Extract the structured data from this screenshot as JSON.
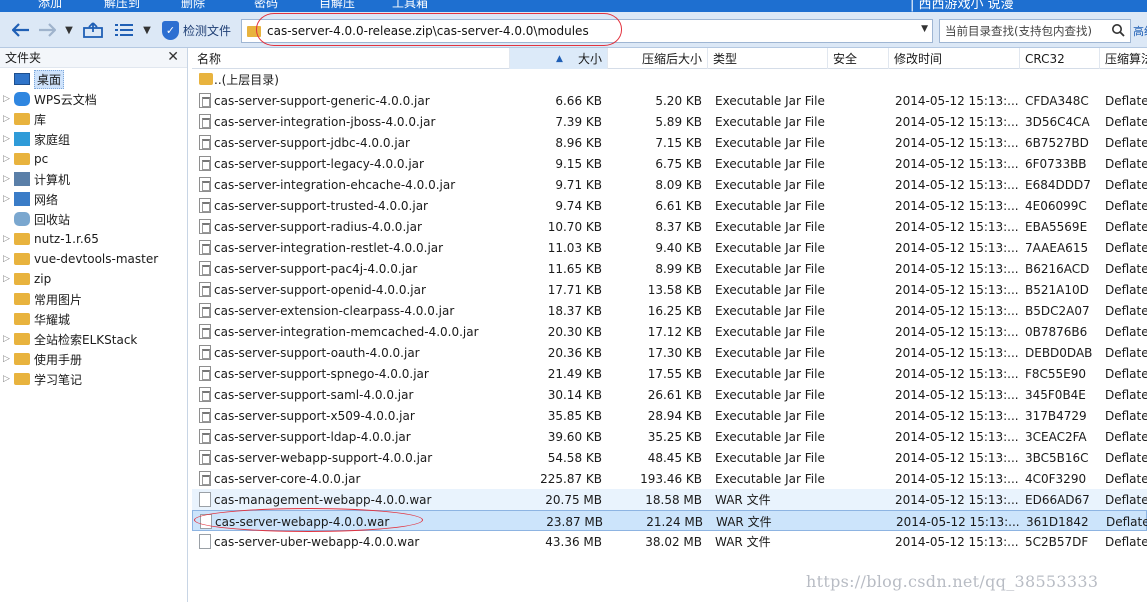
{
  "ribbon": {
    "items": [
      "添加",
      "解压到",
      "删除",
      "密码",
      "自解压",
      "工具箱"
    ],
    "right_text": "| 西西游戏小 说漫"
  },
  "nav": {
    "back_icon": "back-arrow-icon",
    "forward_icon": "forward-arrow-icon",
    "detect_label": "检测文件",
    "path": "cas-server-4.0.0-release.zip\\cas-server-4.0.0\\modules",
    "search_placeholder": "当前目录查找(支持包内查找)",
    "advanced": "高级"
  },
  "tree": {
    "title": "文件夹",
    "items": [
      {
        "label": "桌面",
        "icon": "desktop-icon",
        "selected": true
      },
      {
        "label": "WPS云文档",
        "icon": "cloud-icon"
      },
      {
        "label": "库",
        "icon": "library-icon"
      },
      {
        "label": "家庭组",
        "icon": "homegroup-icon"
      },
      {
        "label": "pc",
        "icon": "user-folder-icon"
      },
      {
        "label": "计算机",
        "icon": "computer-icon"
      },
      {
        "label": "网络",
        "icon": "network-icon"
      },
      {
        "label": "回收站",
        "icon": "recycle-bin-icon"
      },
      {
        "label": "nutz-1.r.65",
        "icon": "folder-icon"
      },
      {
        "label": "vue-devtools-master",
        "icon": "folder-icon"
      },
      {
        "label": "zip",
        "icon": "folder-icon"
      },
      {
        "label": "常用图片",
        "icon": "folder-icon"
      },
      {
        "label": "华耀城",
        "icon": "folder-icon"
      },
      {
        "label": "全站检索ELKStack",
        "icon": "folder-icon"
      },
      {
        "label": "使用手册",
        "icon": "folder-icon"
      },
      {
        "label": "学习笔记",
        "icon": "folder-icon"
      }
    ]
  },
  "columns": {
    "name": "名称",
    "size": "大小",
    "packed": "压缩后大小",
    "type": "类型",
    "security": "安全",
    "modified": "修改时间",
    "crc": "CRC32",
    "method": "压缩算法"
  },
  "up_row": "..(上层目录)",
  "files": [
    {
      "name": "cas-server-support-generic-4.0.0.jar",
      "size": "6.66 KB",
      "packed": "5.20 KB",
      "type": "Executable Jar File",
      "modified": "2014-05-12 15:13:...",
      "crc": "CFDA348C",
      "method": "Deflate"
    },
    {
      "name": "cas-server-integration-jboss-4.0.0.jar",
      "size": "7.39 KB",
      "packed": "5.89 KB",
      "type": "Executable Jar File",
      "modified": "2014-05-12 15:13:...",
      "crc": "3D56C4CA",
      "method": "Deflate"
    },
    {
      "name": "cas-server-support-jdbc-4.0.0.jar",
      "size": "8.96 KB",
      "packed": "7.15 KB",
      "type": "Executable Jar File",
      "modified": "2014-05-12 15:13:...",
      "crc": "6B7527BD",
      "method": "Deflate"
    },
    {
      "name": "cas-server-support-legacy-4.0.0.jar",
      "size": "9.15 KB",
      "packed": "6.75 KB",
      "type": "Executable Jar File",
      "modified": "2014-05-12 15:13:...",
      "crc": "6F0733BB",
      "method": "Deflate"
    },
    {
      "name": "cas-server-integration-ehcache-4.0.0.jar",
      "size": "9.71 KB",
      "packed": "8.09 KB",
      "type": "Executable Jar File",
      "modified": "2014-05-12 15:13:...",
      "crc": "E684DDD7",
      "method": "Deflate"
    },
    {
      "name": "cas-server-support-trusted-4.0.0.jar",
      "size": "9.74 KB",
      "packed": "6.61 KB",
      "type": "Executable Jar File",
      "modified": "2014-05-12 15:13:...",
      "crc": "4E06099C",
      "method": "Deflate"
    },
    {
      "name": "cas-server-support-radius-4.0.0.jar",
      "size": "10.70 KB",
      "packed": "8.37 KB",
      "type": "Executable Jar File",
      "modified": "2014-05-12 15:13:...",
      "crc": "EBA5569E",
      "method": "Deflate"
    },
    {
      "name": "cas-server-integration-restlet-4.0.0.jar",
      "size": "11.03 KB",
      "packed": "9.40 KB",
      "type": "Executable Jar File",
      "modified": "2014-05-12 15:13:...",
      "crc": "7AAEA615",
      "method": "Deflate"
    },
    {
      "name": "cas-server-support-pac4j-4.0.0.jar",
      "size": "11.65 KB",
      "packed": "8.99 KB",
      "type": "Executable Jar File",
      "modified": "2014-05-12 15:13:...",
      "crc": "B6216ACD",
      "method": "Deflate"
    },
    {
      "name": "cas-server-support-openid-4.0.0.jar",
      "size": "17.71 KB",
      "packed": "13.58 KB",
      "type": "Executable Jar File",
      "modified": "2014-05-12 15:13:...",
      "crc": "B521A10D",
      "method": "Deflate"
    },
    {
      "name": "cas-server-extension-clearpass-4.0.0.jar",
      "size": "18.37 KB",
      "packed": "16.25 KB",
      "type": "Executable Jar File",
      "modified": "2014-05-12 15:13:...",
      "crc": "B5DC2A07",
      "method": "Deflate"
    },
    {
      "name": "cas-server-integration-memcached-4.0.0.jar",
      "size": "20.30 KB",
      "packed": "17.12 KB",
      "type": "Executable Jar File",
      "modified": "2014-05-12 15:13:...",
      "crc": "0B7876B6",
      "method": "Deflate"
    },
    {
      "name": "cas-server-support-oauth-4.0.0.jar",
      "size": "20.36 KB",
      "packed": "17.30 KB",
      "type": "Executable Jar File",
      "modified": "2014-05-12 15:13:...",
      "crc": "DEBD0DAB",
      "method": "Deflate"
    },
    {
      "name": "cas-server-support-spnego-4.0.0.jar",
      "size": "21.49 KB",
      "packed": "17.55 KB",
      "type": "Executable Jar File",
      "modified": "2014-05-12 15:13:...",
      "crc": "F8C55E90",
      "method": "Deflate"
    },
    {
      "name": "cas-server-support-saml-4.0.0.jar",
      "size": "30.14 KB",
      "packed": "26.61 KB",
      "type": "Executable Jar File",
      "modified": "2014-05-12 15:13:...",
      "crc": "345F0B4E",
      "method": "Deflate"
    },
    {
      "name": "cas-server-support-x509-4.0.0.jar",
      "size": "35.85 KB",
      "packed": "28.94 KB",
      "type": "Executable Jar File",
      "modified": "2014-05-12 15:13:...",
      "crc": "317B4729",
      "method": "Deflate"
    },
    {
      "name": "cas-server-support-ldap-4.0.0.jar",
      "size": "39.60 KB",
      "packed": "35.25 KB",
      "type": "Executable Jar File",
      "modified": "2014-05-12 15:13:...",
      "crc": "3CEAC2FA",
      "method": "Deflate"
    },
    {
      "name": "cas-server-webapp-support-4.0.0.jar",
      "size": "54.58 KB",
      "packed": "48.45 KB",
      "type": "Executable Jar File",
      "modified": "2014-05-12 15:13:...",
      "crc": "3BC5B16C",
      "method": "Deflate"
    },
    {
      "name": "cas-server-core-4.0.0.jar",
      "size": "225.87 KB",
      "packed": "193.46 KB",
      "type": "Executable Jar File",
      "modified": "2014-05-12 15:13:...",
      "crc": "4C0F3290",
      "method": "Deflate"
    },
    {
      "name": "cas-management-webapp-4.0.0.war",
      "size": "20.75 MB",
      "packed": "18.58 MB",
      "type": "WAR 文件",
      "modified": "2014-05-12 15:13:...",
      "crc": "ED66AD67",
      "method": "Deflate",
      "state": "hover"
    },
    {
      "name": "cas-server-webapp-4.0.0.war",
      "size": "23.87 MB",
      "packed": "21.24 MB",
      "type": "WAR 文件",
      "modified": "2014-05-12 15:13:...",
      "crc": "361D1842",
      "method": "Deflate",
      "state": "selected"
    },
    {
      "name": "cas-server-uber-webapp-4.0.0.war",
      "size": "43.36 MB",
      "packed": "38.02 MB",
      "type": "WAR 文件",
      "modified": "2014-05-12 15:13:...",
      "crc": "5C2B57DF",
      "method": "Deflate"
    }
  ],
  "watermark": "https://blog.csdn.net/qq_38553333",
  "colors": {
    "accent": "#1e6fd0",
    "selection": "#cce4fb",
    "annotation": "#e2333f",
    "folder": "#e8b33e"
  }
}
